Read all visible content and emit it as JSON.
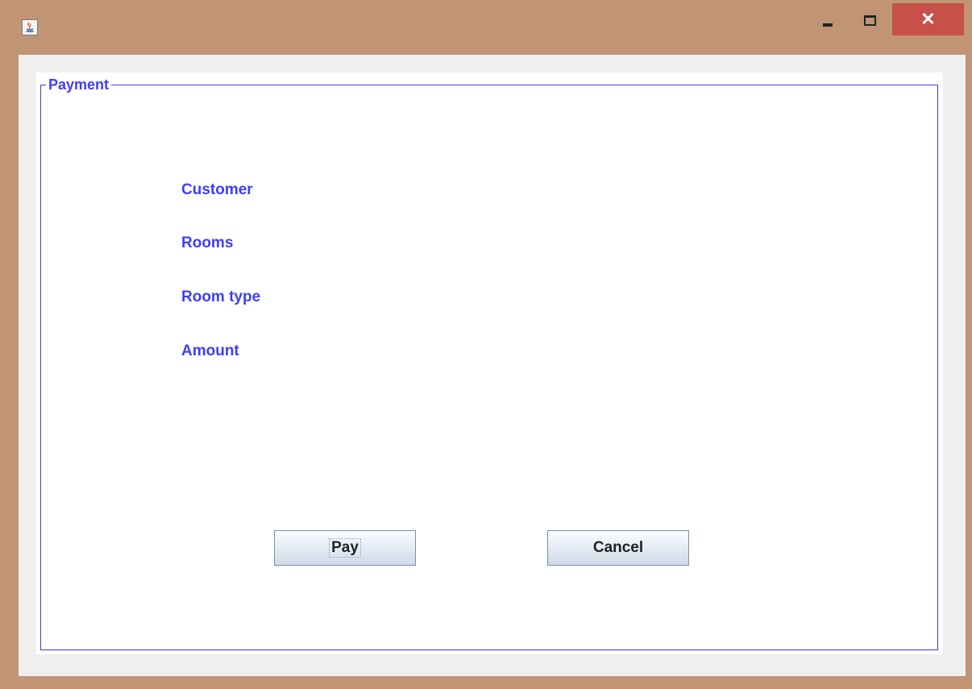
{
  "window": {
    "icon": "java-cup-icon",
    "controls": {
      "minimize_icon": "minimize-icon",
      "maximize_icon": "maximize-icon",
      "close_symbol": "✕"
    }
  },
  "payment": {
    "legend": "Payment",
    "labels": [
      "Customer",
      "Rooms",
      "Room type",
      "Amount"
    ],
    "buttons": {
      "pay": "Pay",
      "cancel": "Cancel"
    }
  },
  "colors": {
    "accent_text": "#3d3dff",
    "border": "#3a3aee",
    "close_button": "#c7504a",
    "frame": "#c09475"
  }
}
